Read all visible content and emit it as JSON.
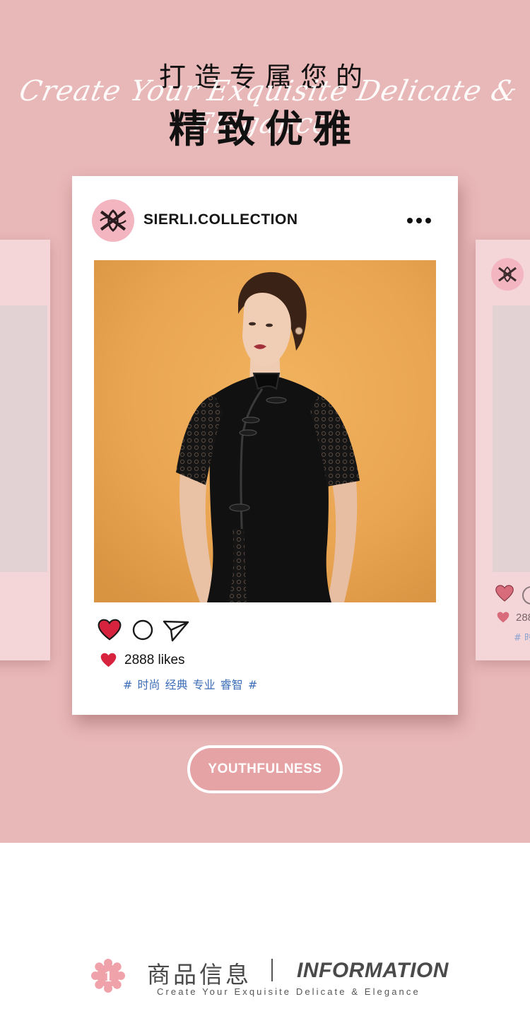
{
  "hero": {
    "title_line1": "打造专属您的",
    "script_text": "Create Your Exquisite Delicate & Elegance",
    "title_line2": "精致优雅",
    "background_color": "#e8b7b8"
  },
  "post": {
    "account_name": "SIERLI.COLLECTION",
    "avatar_icon": "brand-monogram-icon",
    "more_icon": "more-dots-icon",
    "action_icons": [
      "heart-icon",
      "comment-icon",
      "send-icon"
    ],
    "likes_label": "2888 likes",
    "hashtags": "# 时尚 经典 专业 睿智 #",
    "heart_color": "#d8233f",
    "hashtag_color": "#3d6db7"
  },
  "ghost_card": {
    "likes_partial": "288",
    "tags_partial": "# 时"
  },
  "pill_button": {
    "label": "YOUTHFULNESS"
  },
  "section": {
    "number": "1",
    "title_cn": "商品信息",
    "title_en": "INFORMATION",
    "subtitle": "Create Your Exquisite Delicate & Elegance"
  }
}
